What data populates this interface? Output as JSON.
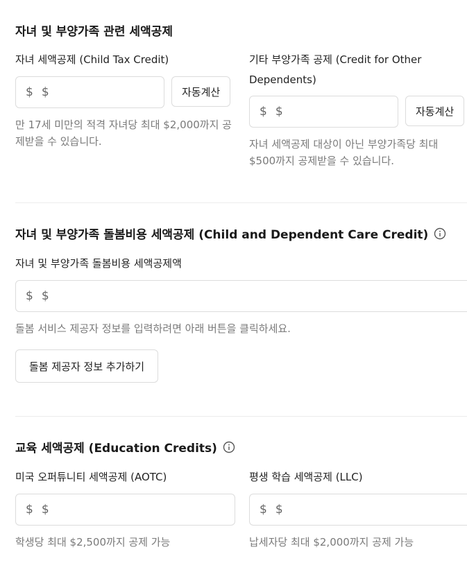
{
  "child_section": {
    "title": "자녀 및 부양가족 관련 세액공제",
    "child_tax_credit": {
      "label": "자녀 세액공제 (Child Tax Credit)",
      "prefix": "$",
      "placeholder": "$",
      "auto_button": "자동계산",
      "help": "만 17세 미만의 적격 자녀당 최대 $2,000까지 공제받을 수 있습니다."
    },
    "other_dependents": {
      "label": "기타 부양가족 공제 (Credit for Other Dependents)",
      "prefix": "$",
      "placeholder": "$",
      "auto_button": "자동계산",
      "help": "자녀 세액공제 대상이 아닌 부양가족당 최대 $500까지 공제받을 수 있습니다."
    }
  },
  "care_section": {
    "title": "자녀 및 부양가족 돌봄비용 세액공제 (Child and Dependent Care Credit)",
    "info_icon": "info-circle-icon",
    "label": "자녀 및 부양가족 돌봄비용 세액공제액",
    "prefix": "$",
    "placeholder": "$",
    "help": "돌봄 서비스 제공자 정보를 입력하려면 아래 버튼을 클릭하세요.",
    "add_provider_button": "돌봄 제공자 정보 추가하기"
  },
  "education_section": {
    "title": "교육 세액공제 (Education Credits)",
    "info_icon": "info-circle-icon",
    "aotc": {
      "label": "미국 오퍼튜니티 세액공제 (AOTC)",
      "prefix": "$",
      "placeholder": "$",
      "help": "학생당 최대 $2,500까지 공제 가능"
    },
    "llc": {
      "label": "평생 학습 세액공제 (LLC)",
      "prefix": "$",
      "placeholder": "$",
      "help": "납세자당 최대 $2,000까지 공제 가능"
    }
  }
}
